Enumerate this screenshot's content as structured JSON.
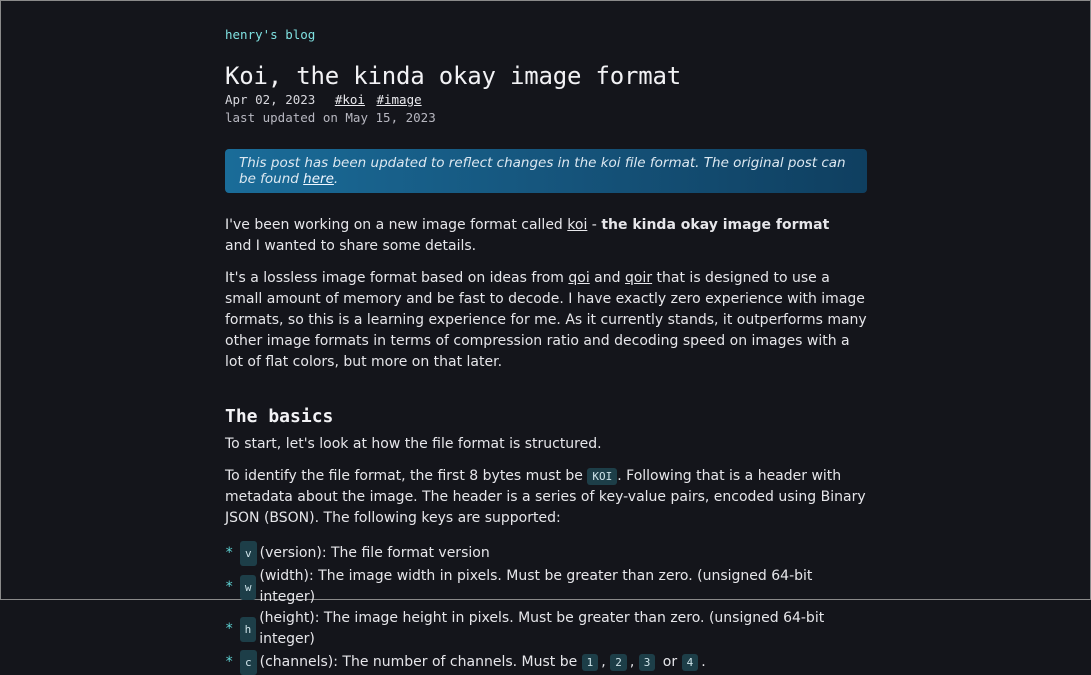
{
  "header": {
    "blog_title": "henry's blog"
  },
  "post": {
    "title": "Koi, the kinda okay image format",
    "date": "Apr 02, 2023",
    "tags": [
      "#koi",
      "#image"
    ],
    "last_updated": "last updated on May 15, 2023"
  },
  "notice": {
    "text": "This post has been updated to reflect changes in the koi file format. The original post can be found ",
    "link_label": "here",
    "end": "."
  },
  "intro": {
    "p1_a": "I've been working on a new image format called ",
    "p1_link": "koi",
    "p1_b": " - ",
    "p1_bold": "the kinda okay image format",
    "p1_c": "and I wanted to share some details.",
    "p2_a": "It's a lossless image format based on ideas from ",
    "p2_link1": "qoi",
    "p2_b": " and ",
    "p2_link2": "qoir",
    "p2_c": " that is designed to use a small amount of memory and be fast to decode. I have exactly zero experience with image formats, so this is a learning experience for me. As it currently stands, it outperforms many other image formats in terms of compression ratio and decoding speed on images with a lot of flat colors, but more on that later."
  },
  "basics": {
    "heading": "The basics",
    "p3": "To start, let's look at how the file format is structured.",
    "p4_a": "To identify the file format, the first 8 bytes must be ",
    "p4_code": "KOI",
    "p4_b": ". Following that is a header with metadata about the image. The header is a series of key-value pairs, encoded using Binary JSON (BSON). The following keys are supported:",
    "keys": [
      {
        "bullet": "*",
        "code": "v",
        "text": "(version): The file format version"
      },
      {
        "bullet": "*",
        "code": "w",
        "text": "(width): The image width in pixels. Must be greater than zero. (unsigned 64-bit integer)"
      },
      {
        "bullet": "*",
        "code": "h",
        "text": "(height): The image height in pixels. Must be greater than zero. (unsigned 64-bit integer)"
      }
    ],
    "channels": {
      "bullet": "*",
      "code": "c",
      "text_a": "(channels): The number of channels. Must be ",
      "vals": [
        "1",
        "2",
        "3",
        "4"
      ],
      "sep1": ", ",
      "sep2": ", ",
      "or": " or ",
      "end": "."
    }
  }
}
